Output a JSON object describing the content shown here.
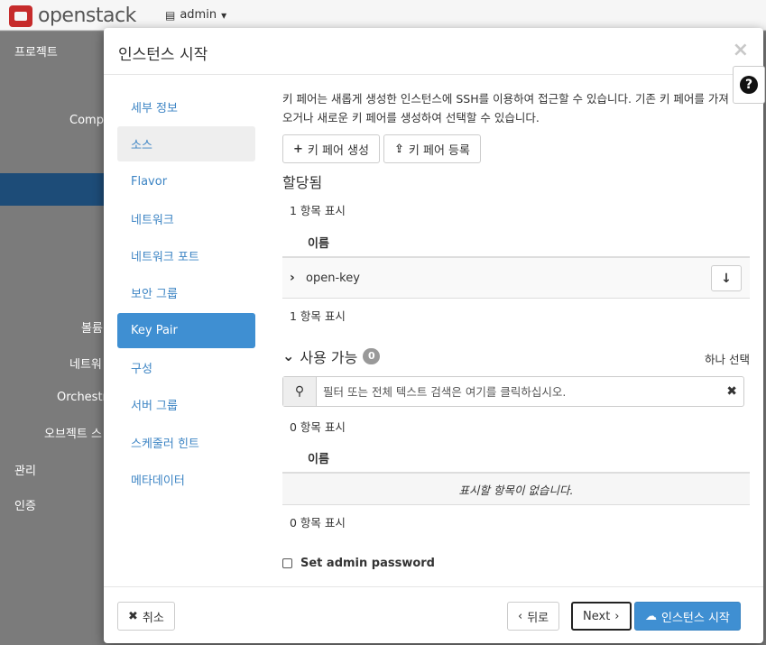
{
  "topbar": {
    "brand": "openstack",
    "user_label": "admin"
  },
  "sidebar": {
    "items": [
      {
        "label": "프로젝트"
      },
      {
        "label": "Compu"
      },
      {
        "label": "볼륨"
      },
      {
        "label": "네트워"
      },
      {
        "label": "Orchestra"
      },
      {
        "label": "오브젝트 스"
      },
      {
        "label": "관리"
      },
      {
        "label": "인증"
      }
    ]
  },
  "modal": {
    "title": "인스턴스 시작",
    "close_label": "×",
    "help_label": "?"
  },
  "wizard": {
    "steps": [
      {
        "label": "세부 정보"
      },
      {
        "label": "소스"
      },
      {
        "label": "Flavor"
      },
      {
        "label": "네트워크"
      },
      {
        "label": "네트워크 포트"
      },
      {
        "label": "보안 그룹"
      },
      {
        "label": "Key Pair"
      },
      {
        "label": "구성"
      },
      {
        "label": "서버 그룹"
      },
      {
        "label": "스케줄러 힌트"
      },
      {
        "label": "메타데이터"
      }
    ]
  },
  "keypair": {
    "description": "키 페어는 새롭게 생성한 인스턴스에 SSH를 이용하여 접근할 수 있습니다. 기존 키 페어를 가져오거나 새로운 키 페어를 생성하여 선택할 수 있습니다.",
    "create_label": "키 페어 생성",
    "import_label": "키 페어 등록",
    "allocated": {
      "title": "할당됨",
      "count_top": "1 항목 표시",
      "column_name": "이름",
      "rows": [
        {
          "name": "open-key"
        }
      ],
      "count_bottom": "1 항목 표시"
    },
    "available": {
      "title": "사용 가능",
      "badge": "0",
      "pick_one": "하나 선택",
      "search_placeholder": "필터 또는 전체 텍스트 검색은 여기를 클릭하십시오.",
      "count_top": "0 항목 표시",
      "column_name": "이름",
      "empty_text": "표시할 항목이 없습니다.",
      "count_bottom": "0 항목 표시"
    }
  },
  "admin_password_label": "Set admin password",
  "footer": {
    "cancel_label": "취소",
    "back_label": "뒤로",
    "next_label": "Next",
    "launch_label": "인스턴스 시작"
  }
}
